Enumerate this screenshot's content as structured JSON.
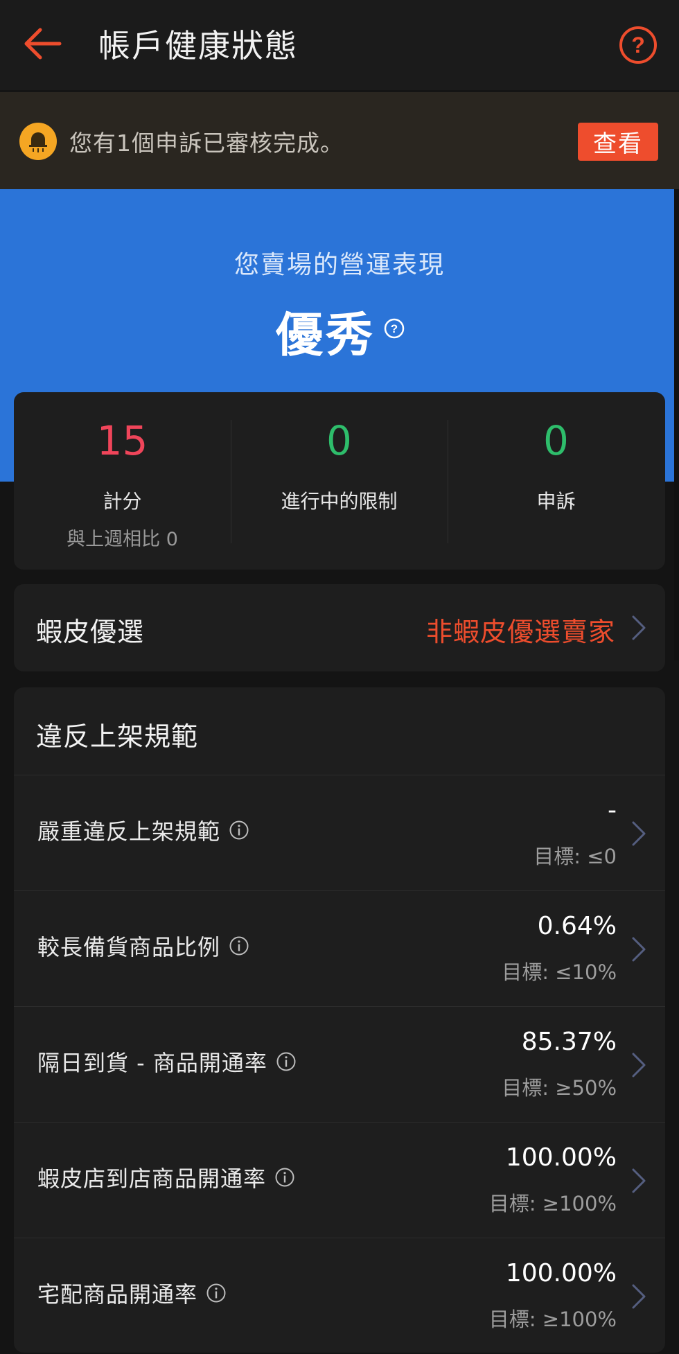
{
  "header": {
    "title": "帳戶健康狀態"
  },
  "notice": {
    "text": "您有1個申訴已審核完成。",
    "button_label": "查看"
  },
  "hero": {
    "subtitle": "您賣場的營運表現",
    "grade": "優秀"
  },
  "stats": [
    {
      "value": "15",
      "label": "計分",
      "compare": "與上週相比 0",
      "color": "#f0455a"
    },
    {
      "value": "0",
      "label": "進行中的限制",
      "color": "#2ebd6b"
    },
    {
      "value": "0",
      "label": "申訴",
      "color": "#2ebd6b"
    }
  ],
  "preferred": {
    "label": "蝦皮優選",
    "status": "非蝦皮優選賣家"
  },
  "listing_section": {
    "title": "違反上架規範",
    "rows": [
      {
        "label": "嚴重違反上架規範",
        "value": "-",
        "target": "目標: ≤0"
      },
      {
        "label": "較長備貨商品比例",
        "value": "0.64%",
        "target": "目標: ≤10%"
      },
      {
        "label": "隔日到貨 - 商品開通率",
        "value": "85.37%",
        "target": "目標: ≥50%"
      },
      {
        "label": "蝦皮店到店商品開通率",
        "value": "100.00%",
        "target": "目標: ≥100%"
      },
      {
        "label": "宅配商品開通率",
        "value": "100.00%",
        "target": "目標: ≥100%"
      }
    ]
  },
  "colors": {
    "accent": "#ee4d2d",
    "hero_blue": "#2b74d8",
    "bell_orange": "#f5a623",
    "score_red": "#f0455a",
    "ok_green": "#2ebd6b"
  },
  "icons": [
    "back-arrow-icon",
    "help-circle-icon",
    "bell-icon",
    "question-icon",
    "chevron-right-icon",
    "info-icon"
  ]
}
